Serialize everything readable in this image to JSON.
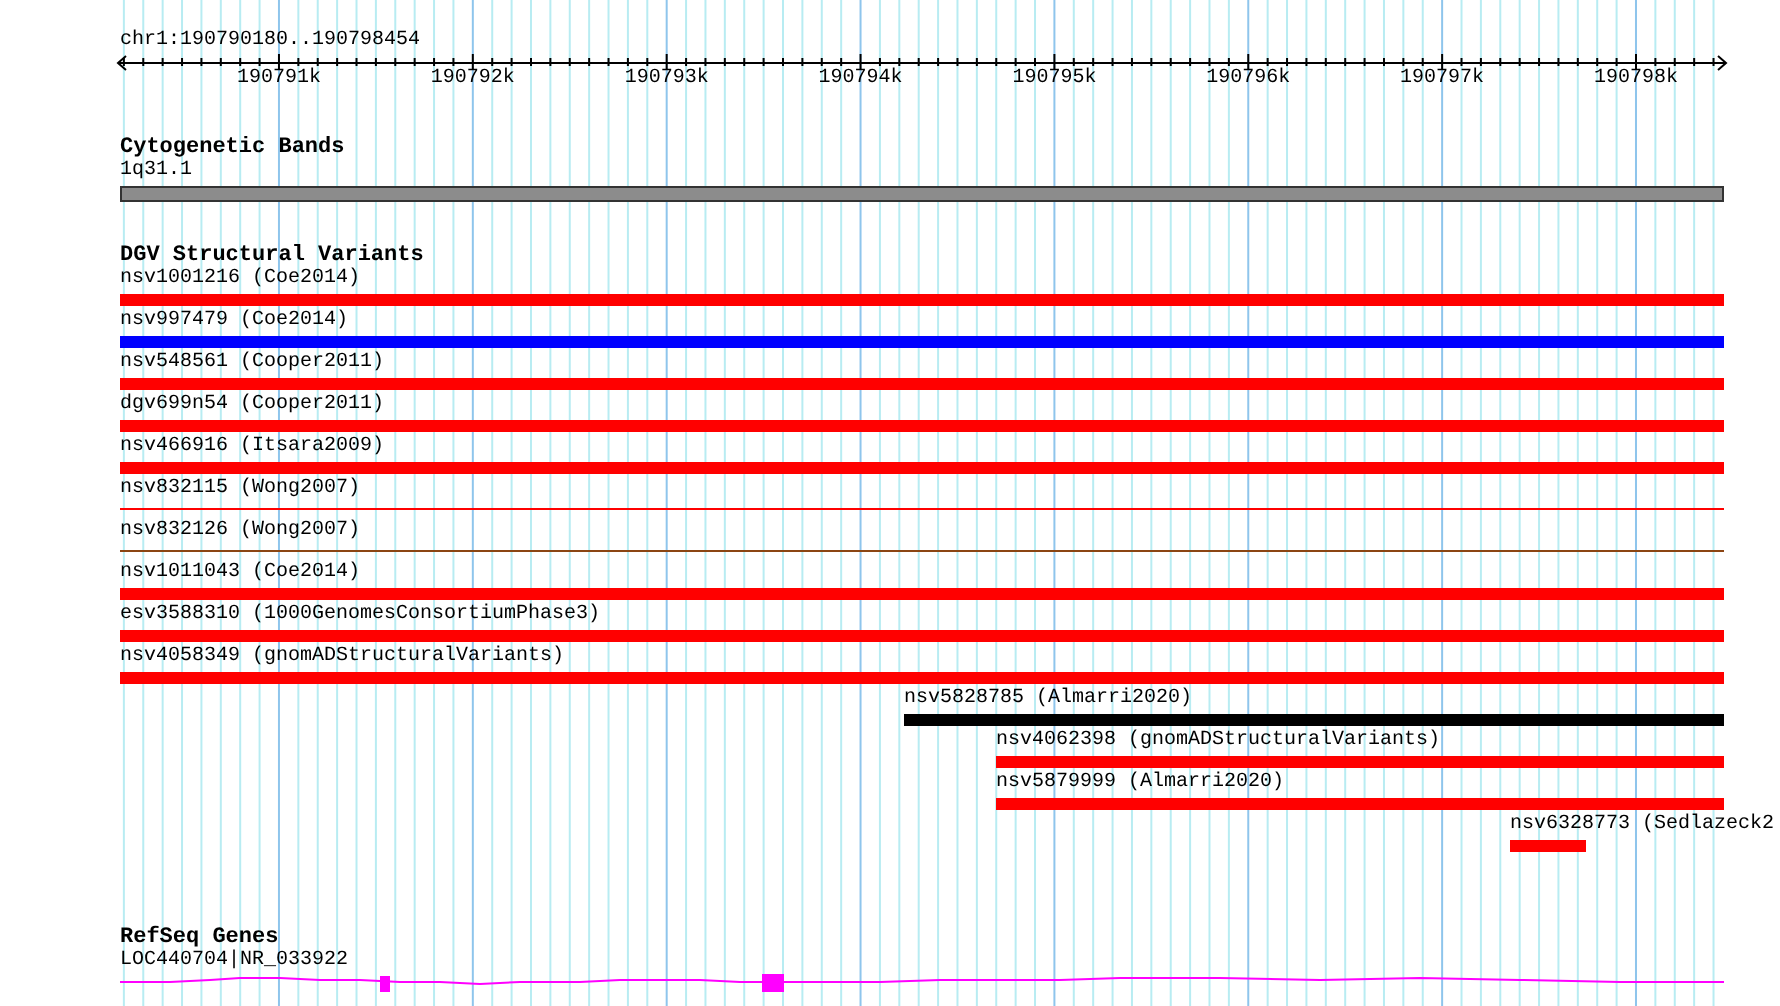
{
  "region": "chr1:190790180..190798454",
  "ruler": {
    "ticks": [
      "190791k",
      "190792k",
      "190793k",
      "190794k",
      "190795k",
      "190796k",
      "190797k",
      "190798k"
    ]
  },
  "tracks": [
    {
      "kind": "cytoband",
      "title": "Cytogenetic Bands",
      "features": [
        {
          "label": "1q31.1"
        }
      ]
    },
    {
      "kind": "variants",
      "title": "DGV Structural Variants",
      "features": [
        {
          "label": "nsv1001216 (Coe2014)",
          "kind": "bar",
          "color": "#ff0000"
        },
        {
          "label": "nsv997479 (Coe2014)",
          "kind": "bar",
          "color": "#0000ff"
        },
        {
          "label": "nsv548561 (Cooper2011)",
          "kind": "bar",
          "color": "#ff0000"
        },
        {
          "label": "dgv699n54 (Cooper2011)",
          "kind": "bar",
          "color": "#ff0000"
        },
        {
          "label": "nsv466916 (Itsara2009)",
          "kind": "bar",
          "color": "#ff0000"
        },
        {
          "label": "nsv832115 (Wong2007)",
          "kind": "line",
          "color": "#ff0000"
        },
        {
          "label": "nsv832126 (Wong2007)",
          "kind": "line",
          "color": "#8b4513"
        },
        {
          "label": "nsv1011043 (Coe2014)",
          "kind": "bar",
          "color": "#ff0000"
        },
        {
          "label": "esv3588310 (1000GenomesConsortiumPhase3)",
          "kind": "bar",
          "color": "#ff0000"
        },
        {
          "label": "nsv4058349 (gnomADStructuralVariants)",
          "kind": "bar",
          "color": "#ff0000"
        },
        {
          "label": "nsv5828785 (Almarri2020)",
          "kind": "bar",
          "color": "#000000"
        },
        {
          "label": "nsv4062398 (gnomADStructuralVariants)",
          "kind": "bar",
          "color": "#ff0000"
        },
        {
          "label": "nsv5879999 (Almarri2020)",
          "kind": "bar",
          "color": "#ff0000"
        },
        {
          "label": "nsv6328773 (Sedlazeck2",
          "kind": "bar",
          "color": "#ff0000"
        }
      ]
    },
    {
      "kind": "genes",
      "title": "RefSeq Genes",
      "features": [
        {
          "label": "LOC440704|NR_033922"
        }
      ]
    }
  ]
}
